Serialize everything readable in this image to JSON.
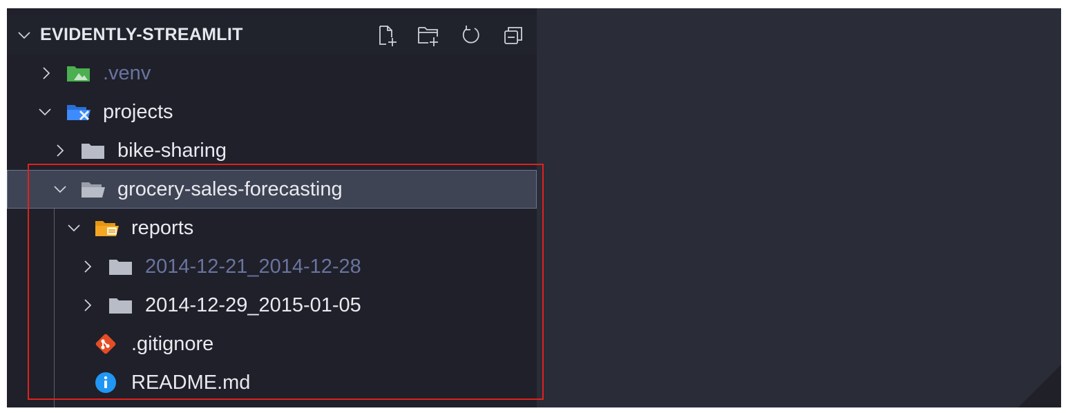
{
  "explorer": {
    "section_title": "EVIDENTLY-STREAMLIT",
    "header_actions": [
      {
        "icon": "new-file-icon"
      },
      {
        "icon": "new-folder-icon"
      },
      {
        "icon": "refresh-icon"
      },
      {
        "icon": "collapse-all-icon"
      }
    ]
  },
  "tree": [
    {
      "label": ".venv",
      "type": "folder",
      "expanded": false,
      "ignored": true,
      "icon": "folder-venv-icon"
    },
    {
      "label": "projects",
      "type": "folder",
      "expanded": true,
      "icon": "folder-projects-icon"
    },
    {
      "label": "bike-sharing",
      "type": "folder",
      "expanded": false,
      "icon": "folder-icon"
    },
    {
      "label": "grocery-sales-forecasting",
      "type": "folder",
      "expanded": true,
      "selected": true,
      "icon": "folder-open-icon"
    },
    {
      "label": "reports",
      "type": "folder",
      "expanded": true,
      "icon": "folder-reports-icon"
    },
    {
      "label": "2014-12-21_2014-12-28",
      "type": "folder",
      "expanded": false,
      "ignored": true,
      "icon": "folder-icon"
    },
    {
      "label": "2014-12-29_2015-01-05",
      "type": "folder",
      "expanded": false,
      "icon": "folder-icon"
    },
    {
      "label": ".gitignore",
      "type": "file",
      "icon": "git-icon"
    },
    {
      "label": "README.md",
      "type": "file",
      "icon": "info-icon"
    }
  ],
  "colors": {
    "sidebar_bg": "#1f2029",
    "editor_bg": "#2a2c37",
    "selection_bg": "#3f4455",
    "highlight_border": "#e0221e",
    "ignored_text": "#6a74a0",
    "folder_grey": "#b8bcc6",
    "folder_green": "#4caf50",
    "folder_blue": "#3d8bfd",
    "folder_yellow": "#f5a623",
    "git_orange": "#e44d26",
    "info_blue": "#2196f3"
  }
}
